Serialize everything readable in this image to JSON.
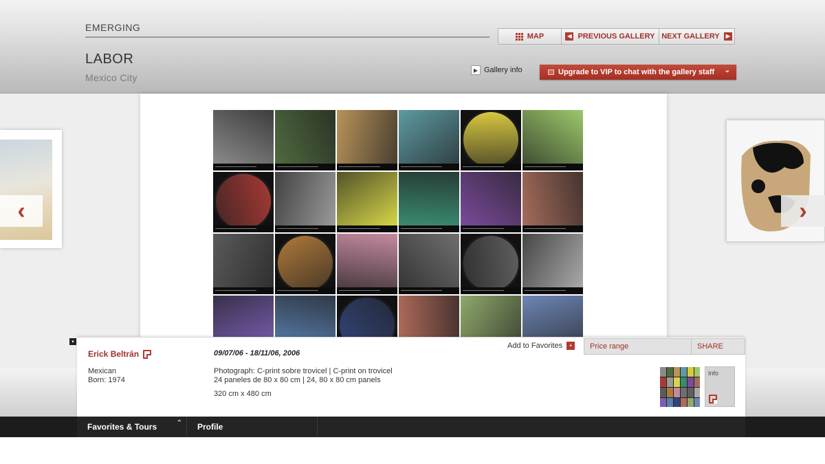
{
  "header": {
    "section": "EMERGING",
    "gallery_name": "LABOR",
    "gallery_city": "Mexico City",
    "nav": {
      "map": "MAP",
      "previous": "PREVIOUS GALLERY",
      "next": "NEXT GALLERY"
    },
    "gallery_info": "Gallery info",
    "vip_button": "Upgrade to VIP to chat with the gallery staff"
  },
  "artwork": {
    "tiles": [
      {
        "c": "#8a8a8a",
        "shape": "rect"
      },
      {
        "c": "#4f6a3f",
        "shape": "rect"
      },
      {
        "c": "#b8935a",
        "shape": "rect"
      },
      {
        "c": "#5e9aa3",
        "shape": "rect"
      },
      {
        "c": "#d8c840",
        "shape": "circle"
      },
      {
        "c": "#9cc96a",
        "shape": "rect"
      },
      {
        "c": "#a83a35",
        "shape": "circle"
      },
      {
        "c": "#9a9a9a",
        "shape": "rect"
      },
      {
        "c": "#d6d648",
        "shape": "rect"
      },
      {
        "c": "#3a8a70",
        "shape": "rect"
      },
      {
        "c": "#7a4a9a",
        "shape": "rect"
      },
      {
        "c": "#a56c5a",
        "shape": "rect"
      },
      {
        "c": "#5a5a5a",
        "shape": "rect"
      },
      {
        "c": "#b07a3a",
        "shape": "circle"
      },
      {
        "c": "#c48aa0",
        "shape": "rect"
      },
      {
        "c": "#6f6f6f",
        "shape": "rect"
      },
      {
        "c": "#5f5f5f",
        "shape": "circle"
      },
      {
        "c": "#a9a9a9",
        "shape": "rect"
      },
      {
        "c": "#7b5fb5",
        "shape": "rect"
      },
      {
        "c": "#5a7fae",
        "shape": "rect"
      },
      {
        "c": "#33447a",
        "shape": "circle"
      },
      {
        "c": "#b06a5a",
        "shape": "rect"
      },
      {
        "c": "#8fa96b",
        "shape": "rect"
      },
      {
        "c": "#6d86b5",
        "shape": "rect"
      }
    ]
  },
  "details": {
    "artist_name": "Erick Beltrán",
    "nationality": "Mexican",
    "born": "Born: 1974",
    "dates": "09/07/06 - 18/11/06, 2006",
    "medium": "Photograph: C-print sobre trovicel | C-print on trovicel",
    "panels": "24 paneles de 80 x 80 cm | 24, 80 x 80 cm panels",
    "size": "320 cm x 480 cm",
    "add_favorites": "Add to Favorites",
    "price_range": "Price range",
    "share": "SHARE",
    "info": "Info"
  },
  "bottom_bar": {
    "favorites_tours": "Favorites & Tours",
    "profile": "Profile"
  },
  "thumb_colors": [
    "#8a8a8a",
    "#4f6a3f",
    "#b8935a",
    "#5e9aa3",
    "#d8c840",
    "#9cc96a",
    "#a83a35",
    "#9a9a9a",
    "#d6d648",
    "#3a8a70",
    "#7a4a9a",
    "#a56c5a",
    "#5a5a5a",
    "#b07a3a",
    "#c48aa0",
    "#6f6f6f",
    "#5f5f5f",
    "#a9a9a9",
    "#7b5fb5",
    "#5a7fae",
    "#33447a",
    "#b06a5a",
    "#8fa96b",
    "#6d86b5"
  ],
  "colors": {
    "accent": "#b13a30",
    "text_accent": "#a0302a"
  }
}
